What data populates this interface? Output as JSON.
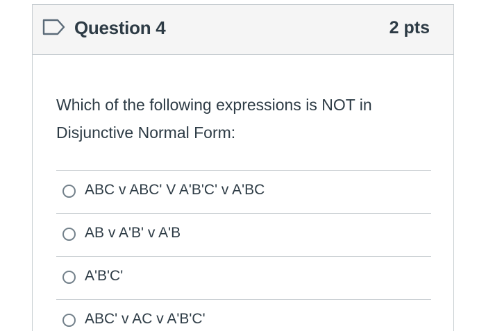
{
  "question": {
    "title": "Question 4",
    "points": "2 pts",
    "flag_icon": "flag-outline-icon",
    "text": "Which of the following expressions is NOT in Disjunctive Normal Form:"
  },
  "answers": [
    {
      "label": "ABC v ABC' V A'B'C' v A'BC",
      "selected": false
    },
    {
      "label": "AB v A'B' v A'B",
      "selected": false
    },
    {
      "label": "A'B'C'",
      "selected": false
    },
    {
      "label": "ABC' v AC v A'B'C'",
      "selected": false
    }
  ],
  "colors": {
    "text": "#2d3b45",
    "border": "#c7cdd1",
    "header_bg": "#f5f5f5",
    "radio_border": "#73818b",
    "flag": "#5a6a78"
  }
}
